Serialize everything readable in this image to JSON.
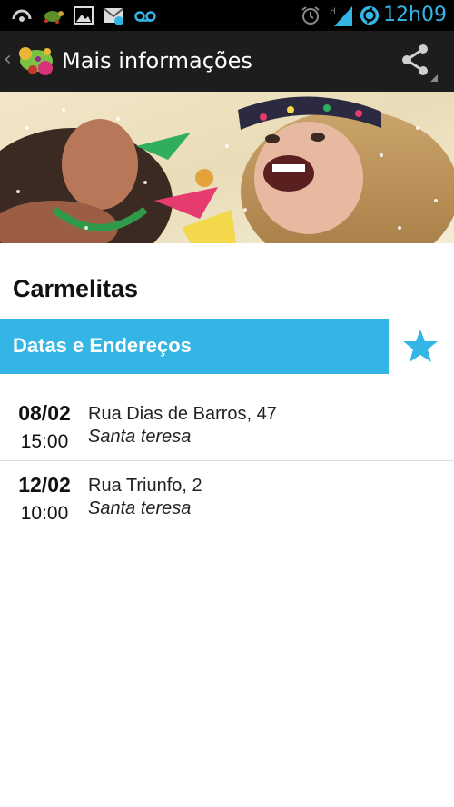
{
  "status_bar": {
    "time": "12h09",
    "network_label": "H",
    "notification_icons": [
      "wave-icon",
      "turtle-app-icon",
      "gallery-icon",
      "mail-icon",
      "voicemail-icon"
    ],
    "status_icons": [
      "alarm-icon",
      "signal-icon",
      "sync-icon"
    ],
    "accent_color": "#33b5e5"
  },
  "action_bar": {
    "title": "Mais informações",
    "up_glyph": "‹",
    "share_icon": "share-icon",
    "background": "#1d1d1d"
  },
  "hero": {
    "image": "carnival-photo"
  },
  "event": {
    "name": "Carmelitas"
  },
  "section": {
    "title": "Datas e Endereços",
    "color": "#33b5e5",
    "favorite_icon": "star-icon"
  },
  "schedule": [
    {
      "date": "08/02",
      "time": "15:00",
      "address": "Rua Dias de Barros, 47",
      "district": "Santa teresa"
    },
    {
      "date": "12/02",
      "time": "10:00",
      "address": "Rua Triunfo, 2",
      "district": "Santa teresa"
    }
  ]
}
